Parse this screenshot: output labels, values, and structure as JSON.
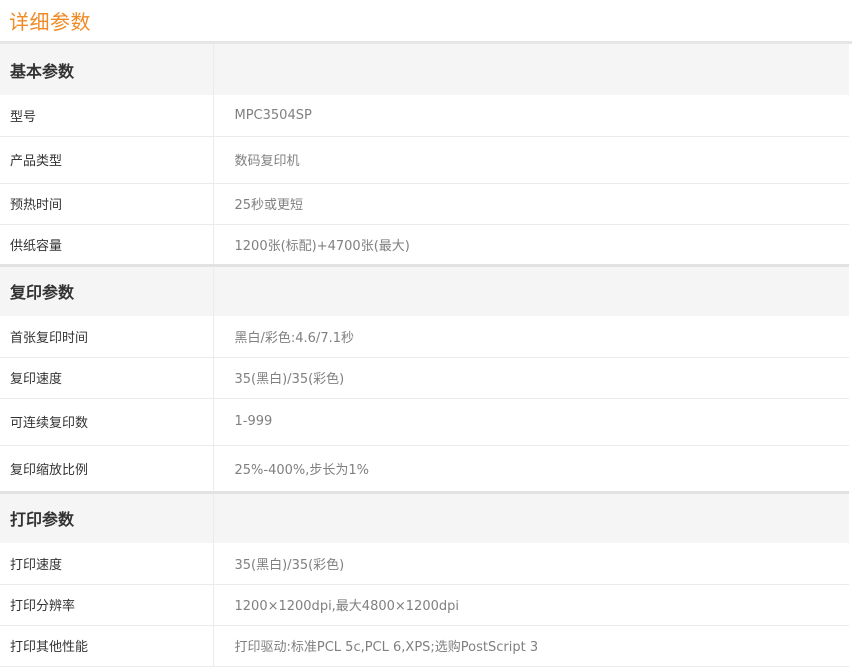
{
  "header": {
    "title": "详细参数"
  },
  "sections": [
    {
      "name": "基本参数",
      "rows": [
        {
          "key": "型号",
          "value": "MPC3504SP"
        },
        {
          "key": "产品类型",
          "value": "数码复印机"
        },
        {
          "key": "预热时间",
          "value": "25秒或更短"
        },
        {
          "key": "供纸容量",
          "value": "1200张(标配)+4700张(最大)"
        }
      ]
    },
    {
      "name": "复印参数",
      "rows": [
        {
          "key": "首张复印时间",
          "value": "黑白/彩色:4.6/7.1秒"
        },
        {
          "key": "复印速度",
          "value": "35(黑白)/35(彩色)"
        },
        {
          "key": "可连续复印数",
          "value": "1-999"
        },
        {
          "key": "复印缩放比例",
          "value": "25%-400%,步长为1%"
        }
      ]
    },
    {
      "name": "打印参数",
      "rows": [
        {
          "key": "打印速度",
          "value": "35(黑白)/35(彩色)"
        },
        {
          "key": "打印分辨率",
          "value": "1200×1200dpi,最大4800×1200dpi"
        },
        {
          "key": "打印其他性能",
          "value": "打印驱动:标准PCL 5c,PCL 6,XPS;选购PostScript 3"
        }
      ]
    }
  ]
}
